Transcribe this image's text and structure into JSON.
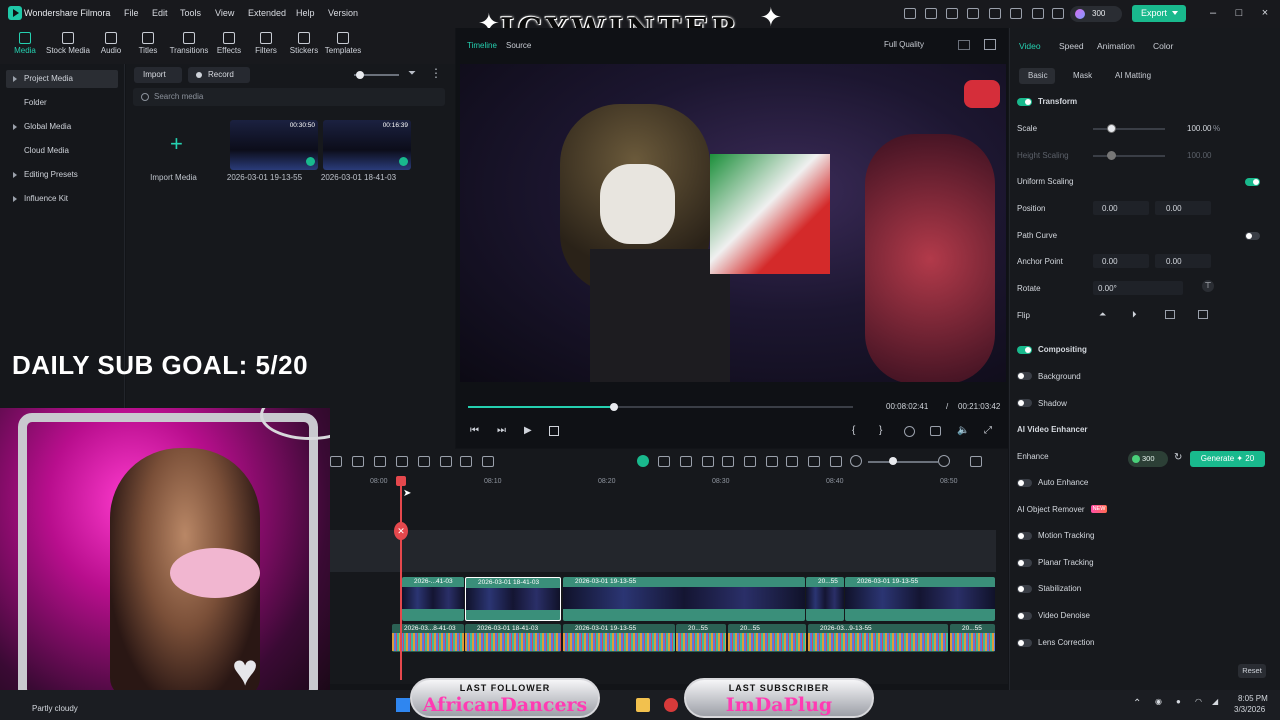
{
  "app": {
    "title": "Wondershare Filmora"
  },
  "menu": [
    "File",
    "Edit",
    "Tools",
    "View",
    "Extended",
    "Help",
    "Version"
  ],
  "header": {
    "credits": "300",
    "export_label": "Export"
  },
  "media_tabs": [
    "Media",
    "Stock Media",
    "Audio",
    "Titles",
    "Transitions",
    "Effects",
    "Filters",
    "Stickers",
    "Templates"
  ],
  "left_nav": [
    "Project Media",
    "Folder",
    "Global Media",
    "Cloud Media",
    "Editing Presets",
    "Influence Kit"
  ],
  "media_toolbar": {
    "import_label": "Import",
    "record_label": "Record",
    "search_placeholder": "Search media"
  },
  "media_items": [
    {
      "caption": "Import Media"
    },
    {
      "caption": "2026-03-01 19-13-55",
      "duration": "00:30:50"
    },
    {
      "caption": "2026-03-01 18-41-03",
      "duration": "00:16:39"
    }
  ],
  "preview": {
    "tab_timeline": "Timeline",
    "tab_source": "Source",
    "quality": "Full Quality",
    "current_time": "00:08:02:41",
    "separator": "/",
    "total_time": "00:21:03:42",
    "progress": 0.38
  },
  "timeline": {
    "ruler": [
      "08:00",
      "08:10",
      "08:20",
      "08:30",
      "08:40",
      "08:50"
    ],
    "video_clips": [
      "2026-...41-03",
      "2026-03-01 18-41-03",
      "2026-03-01 19-13-55",
      "20...55",
      "2026-03-01 19-13-55"
    ],
    "audio_clips": [
      "2026-03...8-41-03",
      "2026-03-01 18-41-03",
      "2026-03-01 19-13-55",
      "20...55",
      "20...55",
      "2026-03...9-13-55",
      "20...55"
    ]
  },
  "props": {
    "tabs": [
      "Video",
      "Speed",
      "Animation",
      "Color"
    ],
    "subtabs": [
      "Basic",
      "Mask",
      "AI Matting"
    ],
    "transform": "Transform",
    "scale_label": "Scale",
    "scale_value": "100.00",
    "scale_unit": "%",
    "height_scaling": "Height Scaling",
    "height_value": "100.00",
    "uniform_scaling": "Uniform Scaling",
    "position_label": "Position",
    "pos_x": "0.00",
    "pos_y": "0.00",
    "path_curve": "Path Curve",
    "anchor_label": "Anchor Point",
    "anc_x": "0.00",
    "anc_y": "0.00",
    "rotate_label": "Rotate",
    "rotate_value": "0.00°",
    "flip_label": "Flip",
    "compositing": "Compositing",
    "background": "Background",
    "shadow": "Shadow",
    "ai_enhancer": "AI Video Enhancer",
    "enhance": "Enhance",
    "enhance_credits": "300",
    "generate": "Generate",
    "generate_count": "20",
    "auto_enhance": "Auto Enhance",
    "object_remover": "AI Object Remover",
    "new_tag": "NEW",
    "motion_tracking": "Motion Tracking",
    "planar_tracking": "Planar Tracking",
    "stabilization": "Stabilization",
    "denoise": "Video Denoise",
    "lens": "Lens Correction",
    "reset": "Reset"
  },
  "overlay": {
    "goal": "DAILY SUB GOAL: 5/20",
    "logo": "ICYWINTER",
    "last_follower_title": "LAST FOLLOWER",
    "last_follower": "AfricanDancers",
    "last_sub_title": "LAST SUBSCRIBER",
    "last_sub": "ImDaPlug"
  },
  "taskbar": {
    "weather": "Partly cloudy",
    "time": "8:05 PM",
    "date": "3/3/2026"
  },
  "colors": {
    "accent": "#19b98d",
    "playhead": "#e5484d",
    "clip": "#3a8f7a"
  }
}
